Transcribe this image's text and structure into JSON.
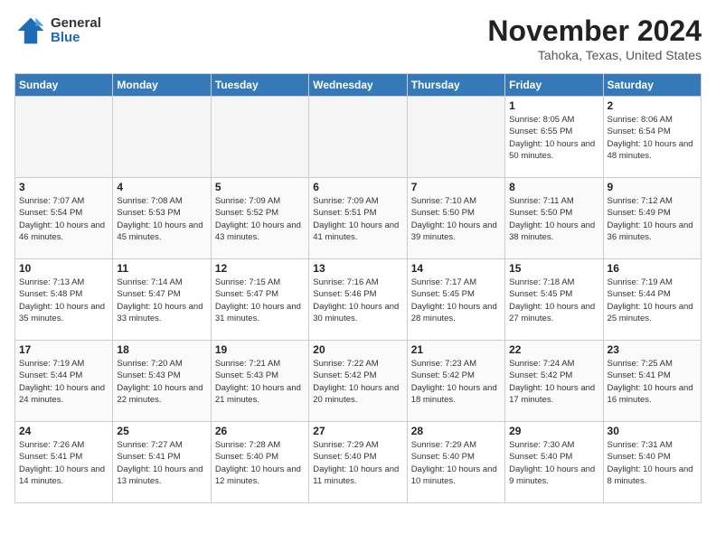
{
  "header": {
    "logo_general": "General",
    "logo_blue": "Blue",
    "month_year": "November 2024",
    "location": "Tahoka, Texas, United States"
  },
  "weekdays": [
    "Sunday",
    "Monday",
    "Tuesday",
    "Wednesday",
    "Thursday",
    "Friday",
    "Saturday"
  ],
  "weeks": [
    [
      {
        "day": "",
        "empty": true
      },
      {
        "day": "",
        "empty": true
      },
      {
        "day": "",
        "empty": true
      },
      {
        "day": "",
        "empty": true
      },
      {
        "day": "",
        "empty": true
      },
      {
        "day": "1",
        "sunrise": "8:05 AM",
        "sunset": "6:55 PM",
        "daylight": "10 hours and 50 minutes."
      },
      {
        "day": "2",
        "sunrise": "8:06 AM",
        "sunset": "6:54 PM",
        "daylight": "10 hours and 48 minutes."
      }
    ],
    [
      {
        "day": "3",
        "sunrise": "7:07 AM",
        "sunset": "5:54 PM",
        "daylight": "10 hours and 46 minutes."
      },
      {
        "day": "4",
        "sunrise": "7:08 AM",
        "sunset": "5:53 PM",
        "daylight": "10 hours and 45 minutes."
      },
      {
        "day": "5",
        "sunrise": "7:09 AM",
        "sunset": "5:52 PM",
        "daylight": "10 hours and 43 minutes."
      },
      {
        "day": "6",
        "sunrise": "7:09 AM",
        "sunset": "5:51 PM",
        "daylight": "10 hours and 41 minutes."
      },
      {
        "day": "7",
        "sunrise": "7:10 AM",
        "sunset": "5:50 PM",
        "daylight": "10 hours and 39 minutes."
      },
      {
        "day": "8",
        "sunrise": "7:11 AM",
        "sunset": "5:50 PM",
        "daylight": "10 hours and 38 minutes."
      },
      {
        "day": "9",
        "sunrise": "7:12 AM",
        "sunset": "5:49 PM",
        "daylight": "10 hours and 36 minutes."
      }
    ],
    [
      {
        "day": "10",
        "sunrise": "7:13 AM",
        "sunset": "5:48 PM",
        "daylight": "10 hours and 35 minutes."
      },
      {
        "day": "11",
        "sunrise": "7:14 AM",
        "sunset": "5:47 PM",
        "daylight": "10 hours and 33 minutes."
      },
      {
        "day": "12",
        "sunrise": "7:15 AM",
        "sunset": "5:47 PM",
        "daylight": "10 hours and 31 minutes."
      },
      {
        "day": "13",
        "sunrise": "7:16 AM",
        "sunset": "5:46 PM",
        "daylight": "10 hours and 30 minutes."
      },
      {
        "day": "14",
        "sunrise": "7:17 AM",
        "sunset": "5:45 PM",
        "daylight": "10 hours and 28 minutes."
      },
      {
        "day": "15",
        "sunrise": "7:18 AM",
        "sunset": "5:45 PM",
        "daylight": "10 hours and 27 minutes."
      },
      {
        "day": "16",
        "sunrise": "7:19 AM",
        "sunset": "5:44 PM",
        "daylight": "10 hours and 25 minutes."
      }
    ],
    [
      {
        "day": "17",
        "sunrise": "7:19 AM",
        "sunset": "5:44 PM",
        "daylight": "10 hours and 24 minutes."
      },
      {
        "day": "18",
        "sunrise": "7:20 AM",
        "sunset": "5:43 PM",
        "daylight": "10 hours and 22 minutes."
      },
      {
        "day": "19",
        "sunrise": "7:21 AM",
        "sunset": "5:43 PM",
        "daylight": "10 hours and 21 minutes."
      },
      {
        "day": "20",
        "sunrise": "7:22 AM",
        "sunset": "5:42 PM",
        "daylight": "10 hours and 20 minutes."
      },
      {
        "day": "21",
        "sunrise": "7:23 AM",
        "sunset": "5:42 PM",
        "daylight": "10 hours and 18 minutes."
      },
      {
        "day": "22",
        "sunrise": "7:24 AM",
        "sunset": "5:42 PM",
        "daylight": "10 hours and 17 minutes."
      },
      {
        "day": "23",
        "sunrise": "7:25 AM",
        "sunset": "5:41 PM",
        "daylight": "10 hours and 16 minutes."
      }
    ],
    [
      {
        "day": "24",
        "sunrise": "7:26 AM",
        "sunset": "5:41 PM",
        "daylight": "10 hours and 14 minutes."
      },
      {
        "day": "25",
        "sunrise": "7:27 AM",
        "sunset": "5:41 PM",
        "daylight": "10 hours and 13 minutes."
      },
      {
        "day": "26",
        "sunrise": "7:28 AM",
        "sunset": "5:40 PM",
        "daylight": "10 hours and 12 minutes."
      },
      {
        "day": "27",
        "sunrise": "7:29 AM",
        "sunset": "5:40 PM",
        "daylight": "10 hours and 11 minutes."
      },
      {
        "day": "28",
        "sunrise": "7:29 AM",
        "sunset": "5:40 PM",
        "daylight": "10 hours and 10 minutes."
      },
      {
        "day": "29",
        "sunrise": "7:30 AM",
        "sunset": "5:40 PM",
        "daylight": "10 hours and 9 minutes."
      },
      {
        "day": "30",
        "sunrise": "7:31 AM",
        "sunset": "5:40 PM",
        "daylight": "10 hours and 8 minutes."
      }
    ]
  ]
}
